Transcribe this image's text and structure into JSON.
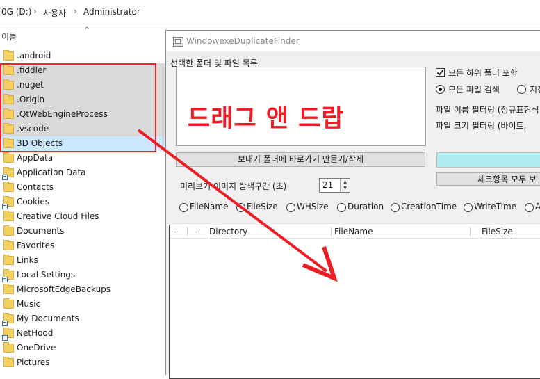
{
  "explorer": {
    "breadcrumb": [
      "0G (D:)",
      "사용자",
      "Administrator"
    ],
    "column_name": "이름",
    "items": [
      {
        "name": ".android",
        "shortcut": false,
        "selected": false
      },
      {
        "name": ".fiddler",
        "shortcut": false,
        "selected": true
      },
      {
        "name": ".nuget",
        "shortcut": false,
        "selected": true
      },
      {
        "name": ".Origin",
        "shortcut": false,
        "selected": true
      },
      {
        "name": ".QtWebEngineProcess",
        "shortcut": false,
        "selected": true
      },
      {
        "name": ".vscode",
        "shortcut": false,
        "selected": true
      },
      {
        "name": "3D Objects",
        "shortcut": false,
        "selected": true
      },
      {
        "name": "AppData",
        "shortcut": false,
        "selected": false
      },
      {
        "name": "Application Data",
        "shortcut": true,
        "selected": false
      },
      {
        "name": "Contacts",
        "shortcut": false,
        "selected": false
      },
      {
        "name": "Cookies",
        "shortcut": true,
        "selected": false
      },
      {
        "name": "Creative Cloud Files",
        "shortcut": false,
        "selected": false
      },
      {
        "name": "Documents",
        "shortcut": false,
        "selected": false
      },
      {
        "name": "Favorites",
        "shortcut": false,
        "selected": false
      },
      {
        "name": "Links",
        "shortcut": false,
        "selected": false
      },
      {
        "name": "Local Settings",
        "shortcut": true,
        "selected": false
      },
      {
        "name": "MicrosoftEdgeBackups",
        "shortcut": false,
        "selected": false
      },
      {
        "name": "Music",
        "shortcut": false,
        "selected": false
      },
      {
        "name": "My Documents",
        "shortcut": true,
        "selected": false
      },
      {
        "name": "NetHood",
        "shortcut": true,
        "selected": false
      },
      {
        "name": "OneDrive",
        "shortcut": false,
        "selected": false
      },
      {
        "name": "Pictures",
        "shortcut": false,
        "selected": false
      }
    ]
  },
  "app": {
    "title": "WindowexeDuplicateFinder",
    "folder_group_label": "선택한 폴더 및 파일 목록",
    "drop_hint": "드래그 앤 드랍",
    "include_subfolders": {
      "label": "모든 하위 폴더 포함",
      "checked": true
    },
    "search_all_files": {
      "label": "모든 파일 검색",
      "selected": true
    },
    "search_specified": {
      "label": "지정",
      "selected": false
    },
    "filename_filter_label": "파일 이름 필터링 (정규표현식",
    "filesize_filter_label": "파일 크기 필터링 (바이트,",
    "sendto_button": "보내기 폴더에 바로가기 만들기/삭제",
    "uncheck_all_button": "체크항목 모두 보",
    "preview_label": "미리보기 이미지 탐색구간 (초)",
    "preview_value": "21",
    "sort_options": [
      "FileName",
      "FileSize",
      "WHSize",
      "Duration",
      "CreationTime",
      "WriteTime",
      "A"
    ],
    "list_columns": [
      "-",
      "-",
      "Directory",
      "FileName",
      "FileSize"
    ]
  },
  "colors": {
    "annotation_red": "#ee1c24",
    "progress": "#aeeef0",
    "selection": "#d9d9d9"
  }
}
